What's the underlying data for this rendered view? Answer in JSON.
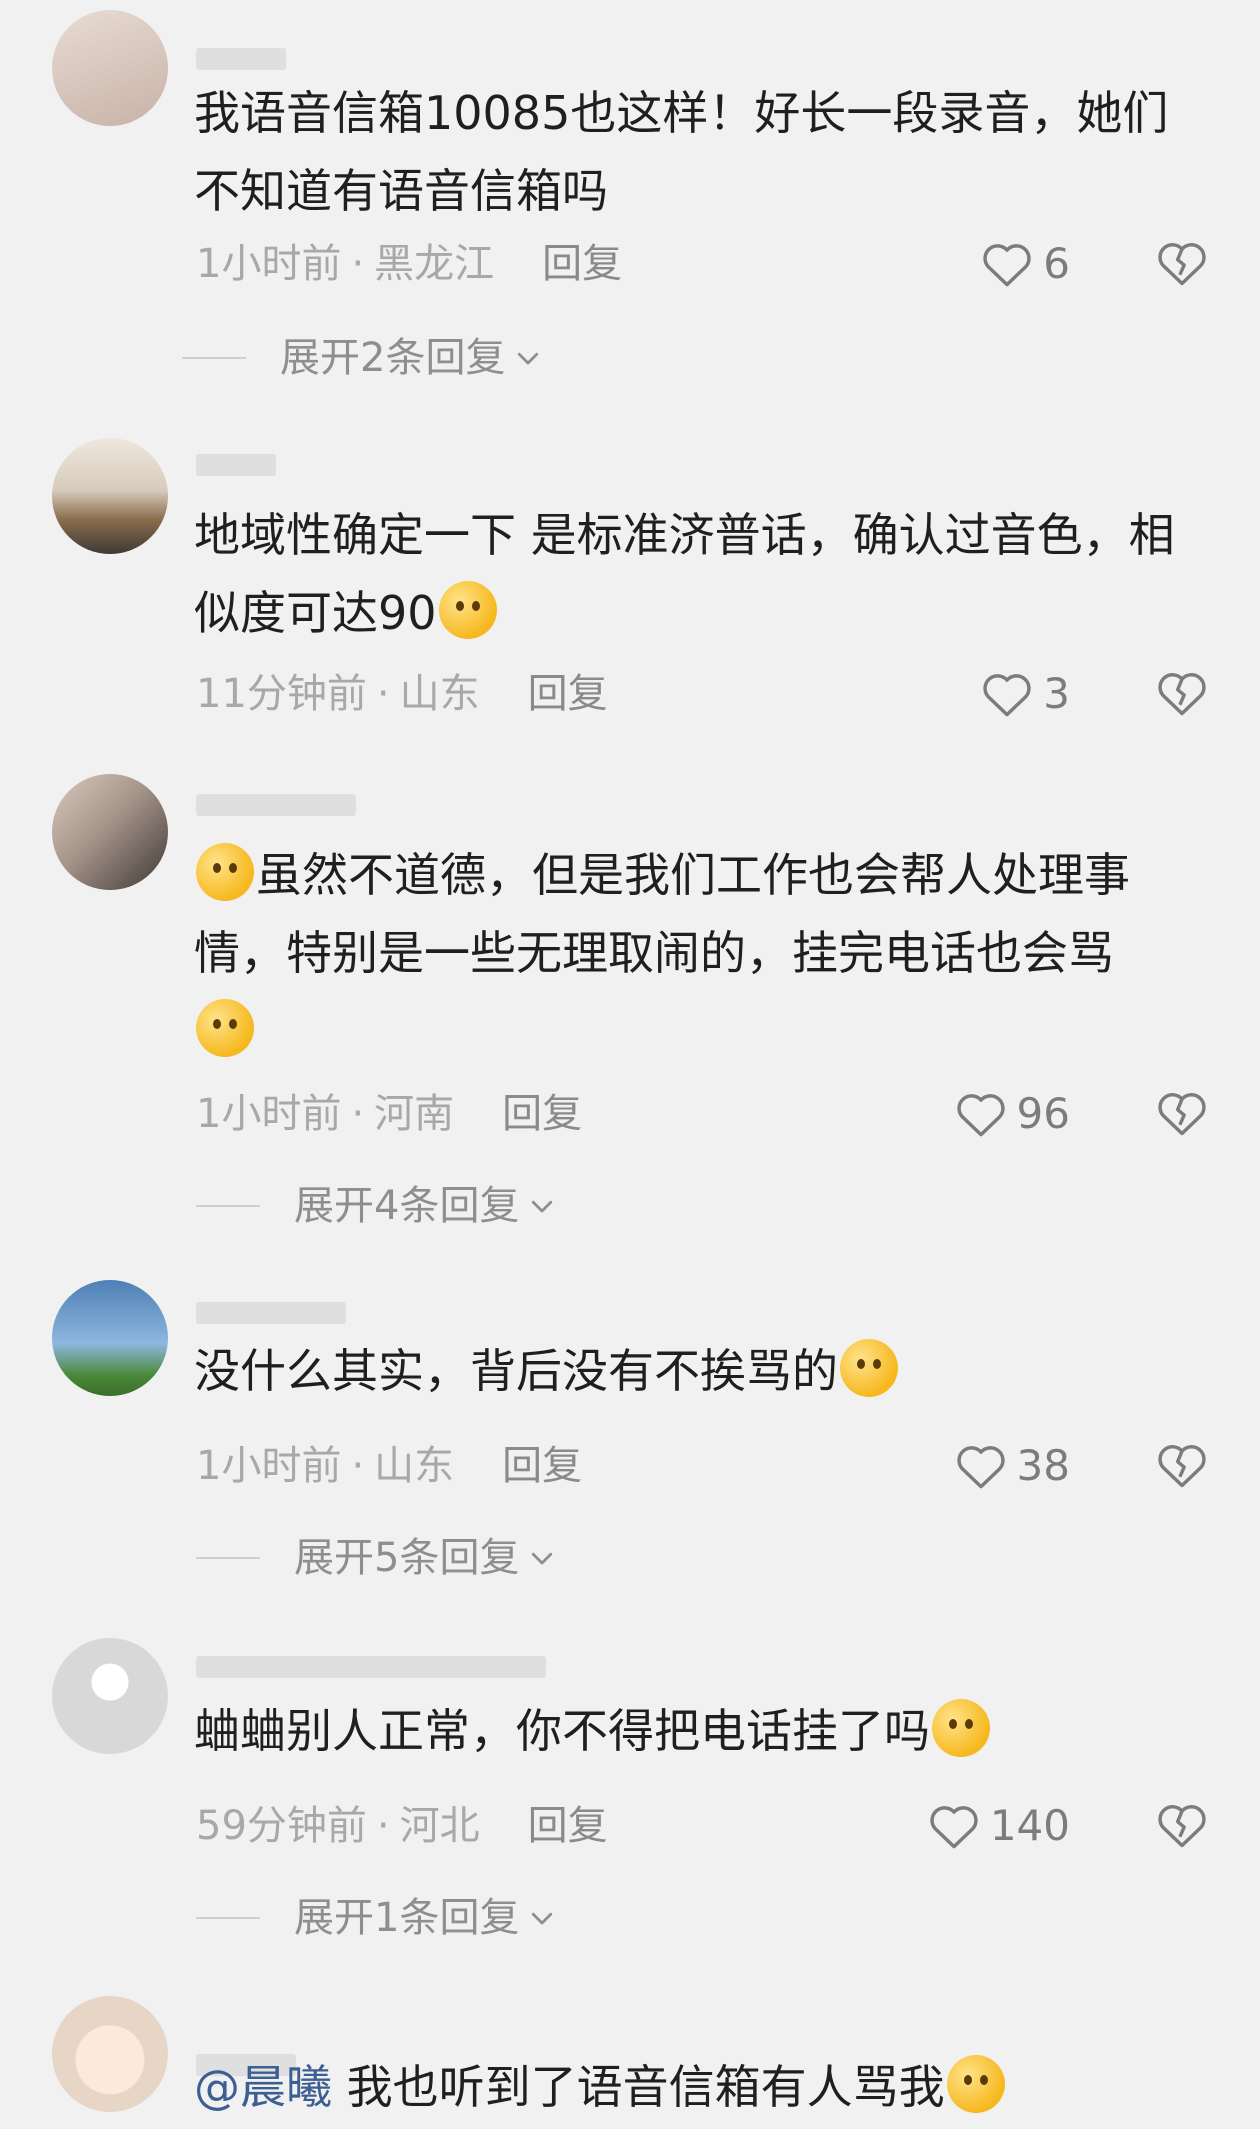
{
  "comments": [
    {
      "text": "我语音信箱10085也这样！好长一段录音，她们不知道有语音信箱吗",
      "time": "1小时前",
      "location": "黑龙江",
      "reply_label": "回复",
      "likes": "6",
      "expand_label": "展开2条回复"
    },
    {
      "text": "地域性确定一下 是标准济普话，确认过音色，相似度可达90",
      "time": "11分钟前",
      "location": "山东",
      "reply_label": "回复",
      "likes": "3"
    },
    {
      "text": "虽然不道德，但是我们工作也会帮人处理事情，特别是一些无理取闹的，挂完电话也会骂",
      "time": "1小时前",
      "location": "河南",
      "reply_label": "回复",
      "likes": "96",
      "expand_label": "展开4条回复"
    },
    {
      "text": "没什么其实，背后没有不挨骂的",
      "time": "1小时前",
      "location": "山东",
      "reply_label": "回复",
      "likes": "38",
      "expand_label": "展开5条回复"
    },
    {
      "text": "蛐蛐别人正常，你不得把电话挂了吗",
      "time": "59分钟前",
      "location": "河北",
      "reply_label": "回复",
      "likes": "140",
      "expand_label": "展开1条回复"
    },
    {
      "mention": "@晨曦",
      "text": "我也听到了语音信箱有人骂我"
    }
  ],
  "meta_separator": "·",
  "icons": {
    "like": "heart-outline-icon",
    "dislike": "broken-heart-icon",
    "expand": "chevron-down-icon"
  }
}
